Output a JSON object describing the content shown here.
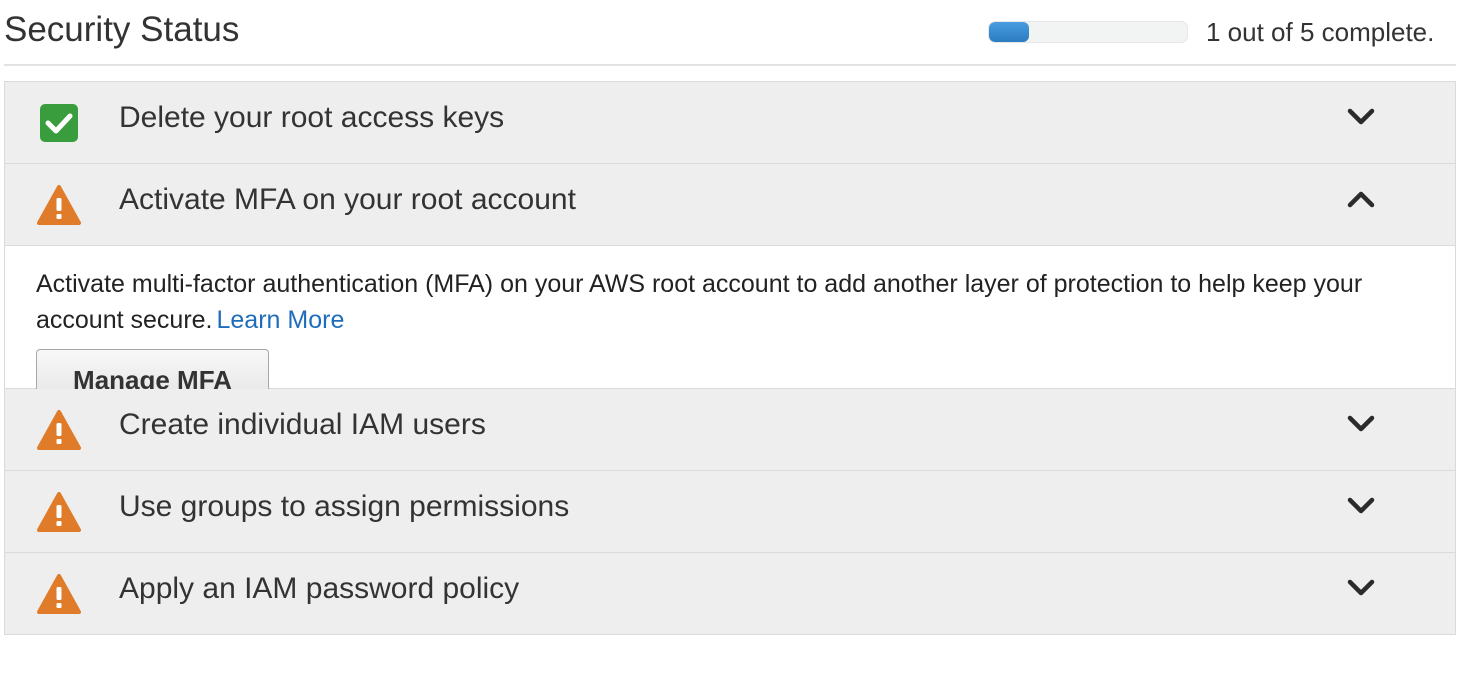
{
  "header": {
    "title": "Security Status",
    "progress": {
      "completed": 1,
      "total": 5,
      "text": "1 out of 5 complete.",
      "fill_color": "#2e7fc4"
    }
  },
  "items": [
    {
      "title": "Delete your root access keys",
      "status": "complete",
      "status_icon": "check-icon",
      "expanded": false,
      "toggle_icon": "chevron-down-icon"
    },
    {
      "title": "Activate MFA on your root account",
      "status": "warning",
      "status_icon": "warning-icon",
      "expanded": true,
      "toggle_icon": "chevron-up-icon",
      "description": "Activate multi-factor authentication (MFA) on your AWS root account to add another layer of protection to help keep your account secure.",
      "link_label": "Learn More",
      "button_label": "Manage MFA"
    },
    {
      "title": "Create individual IAM users",
      "status": "warning",
      "status_icon": "warning-icon",
      "expanded": false,
      "toggle_icon": "chevron-down-icon"
    },
    {
      "title": "Use groups to assign permissions",
      "status": "warning",
      "status_icon": "warning-icon",
      "expanded": false,
      "toggle_icon": "chevron-down-icon"
    },
    {
      "title": "Apply an IAM password policy",
      "status": "warning",
      "status_icon": "warning-icon",
      "expanded": false,
      "toggle_icon": "chevron-down-icon"
    }
  ],
  "colors": {
    "complete": "#3a9d3d",
    "warning": "#e07b29",
    "link": "#1f6dba"
  }
}
